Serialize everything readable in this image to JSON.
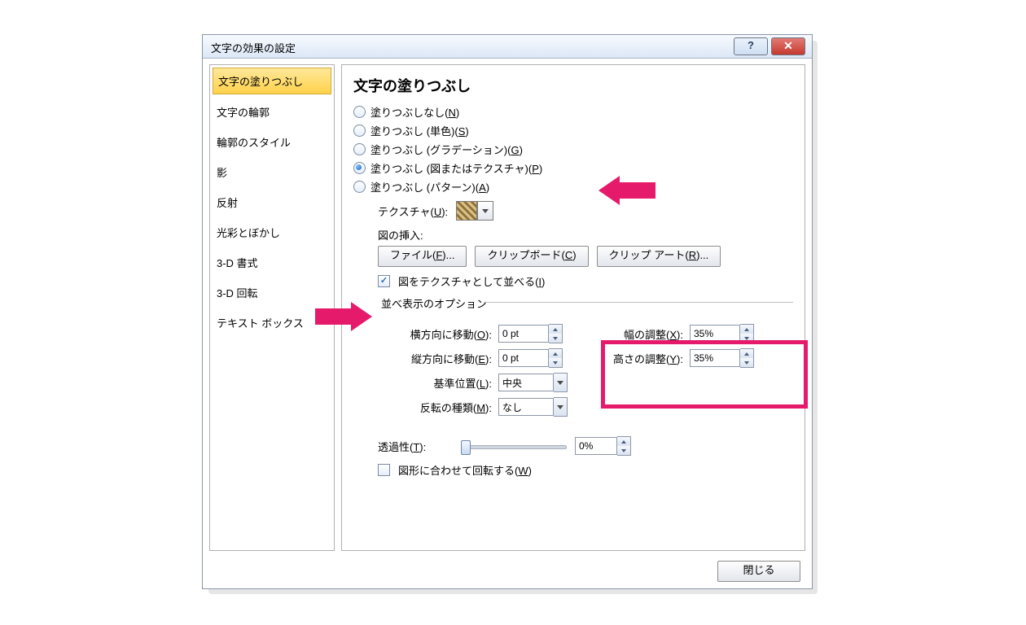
{
  "titlebar": {
    "title": "文字の効果の設定"
  },
  "sidebar": {
    "items": [
      "文字の塗りつぶし",
      "文字の輪郭",
      "輪郭のスタイル",
      "影",
      "反射",
      "光彩とぼかし",
      "3-D 書式",
      "3-D 回転",
      "テキスト ボックス"
    ]
  },
  "content": {
    "heading": "文字の塗りつぶし",
    "radios": {
      "none_pre": "塗りつぶしなし(",
      "none_u": "N",
      "none_post": ")",
      "solid_pre": "塗りつぶし (単色)(",
      "solid_u": "S",
      "solid_post": ")",
      "grad_pre": "塗りつぶし (グラデーション)(",
      "grad_u": "G",
      "grad_post": ")",
      "pic_pre": "塗りつぶし (図またはテクスチャ)(",
      "pic_u": "P",
      "pic_post": ")",
      "pat_pre": "塗りつぶし (パターン)(",
      "pat_u": "A",
      "pat_post": ")"
    },
    "texture_label_pre": "テクスチャ(",
    "texture_label_u": "U",
    "texture_label_post": "):",
    "insert_label": "図の挿入:",
    "btn_file_pre": "ファイル(",
    "btn_file_u": "F",
    "btn_file_post": ")...",
    "btn_clipboard_pre": "クリップボード(",
    "btn_clipboard_u": "C",
    "btn_clipboard_post": ")",
    "btn_clipart_pre": "クリップ アート(",
    "btn_clipart_u": "R",
    "btn_clipart_post": ")...",
    "chk_tile_pre": "図をテクスチャとして並べる(",
    "chk_tile_u": "I",
    "chk_tile_post": ")",
    "fieldset_legend": "並べ表示のオプション",
    "offset_x_pre": "横方向に移動(",
    "offset_x_u": "O",
    "offset_x_post": "):",
    "offset_y_pre": "縦方向に移動(",
    "offset_y_u": "E",
    "offset_y_post": "):",
    "scale_x_pre": "幅の調整(",
    "scale_x_u": "X",
    "scale_x_post": "):",
    "scale_y_pre": "高さの調整(",
    "scale_y_u": "Y",
    "scale_y_post": "):",
    "align_pre": "基準位置(",
    "align_u": "L",
    "align_post": "):",
    "mirror_pre": "反転の種類(",
    "mirror_u": "M",
    "mirror_post": "):",
    "transp_pre": "透過性(",
    "transp_u": "T",
    "transp_post": "):",
    "chk_rotate_pre": "図形に合わせて回転する(",
    "chk_rotate_u": "W",
    "chk_rotate_post": ")",
    "vals": {
      "offset_x": "0 pt",
      "offset_y": "0 pt",
      "scale_x": "35%",
      "scale_y": "35%",
      "align": "中央",
      "mirror": "なし",
      "transp": "0%"
    }
  },
  "footer": {
    "close": "閉じる"
  }
}
